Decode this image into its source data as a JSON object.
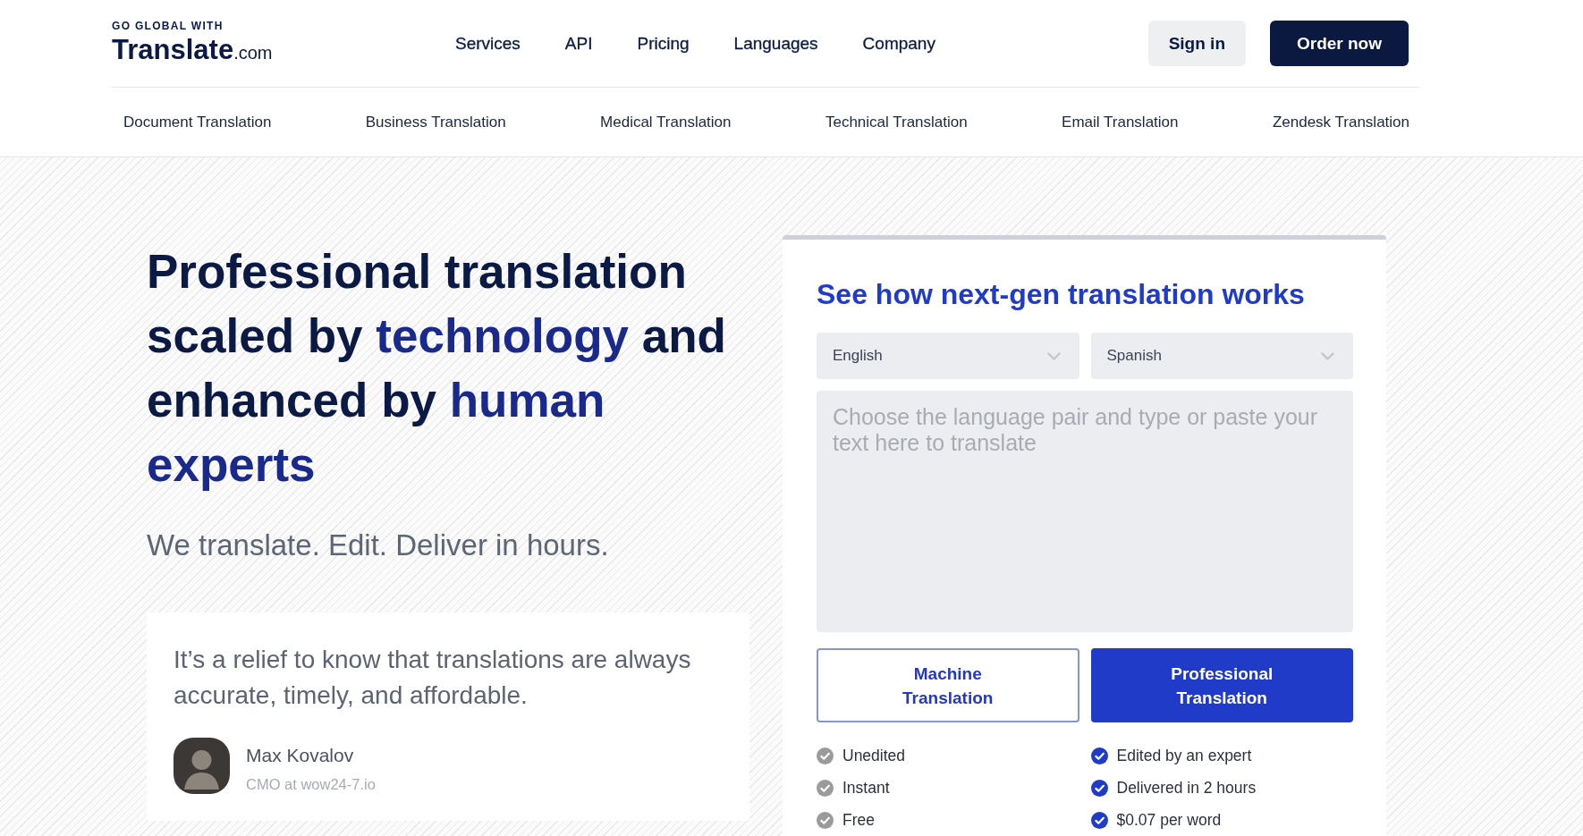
{
  "header": {
    "logo": {
      "tagline": "GO GLOBAL WITH",
      "name": "Translate",
      "suffix": ".com"
    },
    "nav": [
      "Services",
      "API",
      "Pricing",
      "Languages",
      "Company"
    ],
    "actions": [
      {
        "label": "Sign in",
        "kind": "secondary"
      },
      {
        "label": "Order now",
        "kind": "primary"
      }
    ],
    "subnav": [
      "Document Translation",
      "Business Translation",
      "Medical Translation",
      "Technical Translation",
      "Email Translation",
      "Zendesk Translation"
    ]
  },
  "hero": {
    "heading": [
      {
        "text": "Professional translation scaled by ",
        "highlight": false
      },
      {
        "text": "technology",
        "highlight": true
      },
      {
        "text": " and enhanced by ",
        "highlight": false
      },
      {
        "text": "human experts",
        "highlight": true
      }
    ],
    "subtitle": "We translate. Edit. Deliver in hours.",
    "testimonial": {
      "quote": "It’s a relief to know that translations are always accurate, timely, and affordable.",
      "author": "Max Kovalov",
      "role": "CMO at wow24-7.io"
    }
  },
  "translator": {
    "title": "See how next-gen translation works",
    "source_language": "English",
    "target_language": "Spanish",
    "input": {
      "placeholder": "Choose the language pair and type or paste your text here to translate"
    },
    "modes": [
      {
        "label": "Machine Translation",
        "selected": false,
        "features": [
          "Unedited",
          "Instant",
          "Free"
        ]
      },
      {
        "label": "Professional Translation",
        "selected": true,
        "features": [
          "Edited by an expert",
          "Delivered in 2 hours",
          "$0.07 per word"
        ]
      }
    ]
  }
}
